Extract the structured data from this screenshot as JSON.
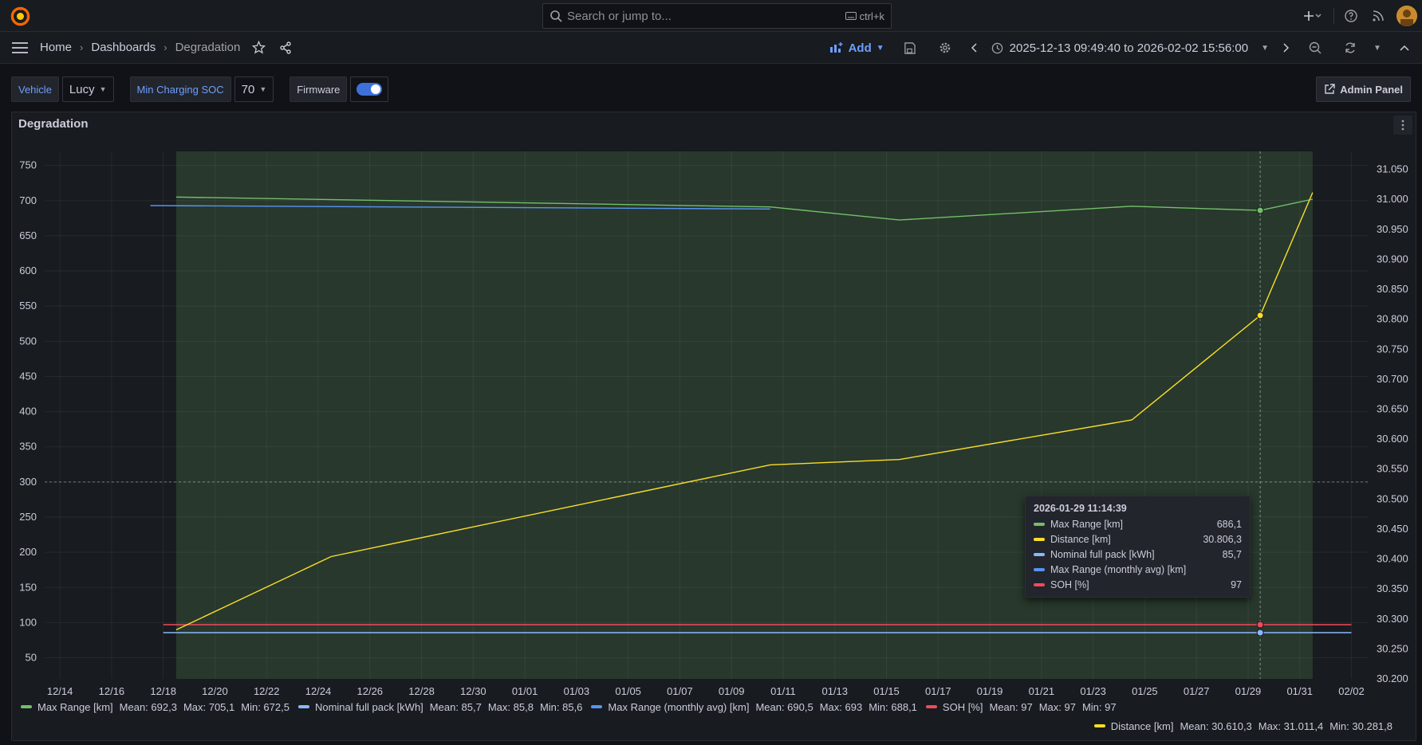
{
  "header": {
    "search_placeholder": "Search or jump to...",
    "search_shortcut": "ctrl+k",
    "icons": [
      "grafana-logo-icon",
      "plus-icon",
      "help-icon",
      "rss-icon",
      "avatar"
    ]
  },
  "nav": {
    "breadcrumb": [
      "Home",
      "Dashboards",
      "Degradation"
    ],
    "add_label": "Add",
    "time_range": "2025-12-13 09:49:40 to 2026-02-02 15:56:00"
  },
  "variables": {
    "vehicle_label": "Vehicle",
    "vehicle_value": "Lucy",
    "soc_label": "Min Charging SOC",
    "soc_value": "70",
    "firmware_label": "Firmware",
    "firmware_on": true,
    "admin_label": "Admin Panel"
  },
  "panel": {
    "title": "Degradation"
  },
  "tooltip": {
    "time": "2026-01-29 11:14:39",
    "rows": [
      {
        "name": "Max Range [km]",
        "value": "686,1",
        "color": "#73bf69"
      },
      {
        "name": "Distance [km]",
        "value": "30.806,3",
        "color": "#fade2a"
      },
      {
        "name": "Nominal full pack [kWh]",
        "value": "85,7",
        "color": "#8ab8ff"
      },
      {
        "name": "Max Range (monthly avg) [km]",
        "value": "",
        "color": "#5794f2"
      },
      {
        "name": "SOH [%]",
        "value": "97",
        "color": "#f2495c"
      }
    ]
  },
  "legend": {
    "row1": [
      {
        "name": "Max Range [km]",
        "color": "#73bf69",
        "mean": "Mean: 692,3",
        "max": "Max: 705,1",
        "min": "Min: 672,5"
      },
      {
        "name": "Nominal full pack [kWh]",
        "color": "#8ab8ff",
        "mean": "Mean: 85,7",
        "max": "Max: 85,8",
        "min": "Min: 85,6"
      },
      {
        "name": "Max Range (monthly avg) [km]",
        "color": "#5794f2",
        "mean": "Mean: 690,5",
        "max": "Max: 693",
        "min": "Min: 688,1"
      },
      {
        "name": "SOH [%]",
        "color": "#f2495c",
        "mean": "Mean: 97",
        "max": "Max: 97",
        "min": "Min: 97"
      }
    ],
    "row2": [
      {
        "name": "Distance [km]",
        "color": "#fade2a",
        "mean": "Mean: 30.610,3",
        "max": "Max: 31.011,4",
        "min": "Min: 30.281,8"
      }
    ]
  },
  "chart_data": {
    "type": "line",
    "x_ticks": [
      "12/14",
      "12/16",
      "12/18",
      "12/20",
      "12/22",
      "12/24",
      "12/26",
      "12/28",
      "12/30",
      "01/01",
      "01/03",
      "01/05",
      "01/07",
      "01/09",
      "01/11",
      "01/13",
      "01/15",
      "01/17",
      "01/19",
      "01/21",
      "01/23",
      "01/25",
      "01/27",
      "01/29",
      "01/31",
      "02/02"
    ],
    "x_range": [
      "2025-12-13 09:49:40",
      "2026-02-02 15:56:00"
    ],
    "y_left_ticks": [
      "750",
      "700",
      "650",
      "600",
      "550",
      "500",
      "450",
      "400",
      "350",
      "300",
      "250",
      "200",
      "150",
      "100",
      "50"
    ],
    "y_left_range": [
      20,
      770
    ],
    "y_right_ticks": [
      "31.050",
      "31.000",
      "30.950",
      "30.900",
      "30.850",
      "30.800",
      "30.750",
      "30.700",
      "30.650",
      "30.600",
      "30.550",
      "30.500",
      "30.450",
      "30.400",
      "30.350",
      "30.300",
      "30.250",
      "30.200"
    ],
    "y_right_range": [
      30.2,
      31.08
    ],
    "shaded_region": [
      "2025-12-18 12:00",
      "2026-01-31 12:00"
    ],
    "series": [
      {
        "name": "Max Range [km]",
        "axis": "left",
        "color": "#73bf69",
        "x": [
          "2025-12-18 12:00",
          "2026-01-10 12:00",
          "2026-01-15 12:00",
          "2026-01-24 12:00",
          "2026-01-29 11:14",
          "2026-01-31 12:00"
        ],
        "y": [
          705.1,
          691,
          672.5,
          692,
          686.1,
          702
        ]
      },
      {
        "name": "Nominal full pack [kWh]",
        "axis": "left",
        "color": "#8ab8ff",
        "x": [
          "2025-12-18 00:00",
          "2026-02-02 00:00"
        ],
        "y": [
          85.7,
          85.7
        ]
      },
      {
        "name": "Max Range (monthly avg) [km]",
        "axis": "left",
        "color": "#5794f2",
        "x": [
          "2025-12-17 12:00",
          "2026-01-10 12:00"
        ],
        "y": [
          693,
          688.1
        ]
      },
      {
        "name": "SOH [%]",
        "axis": "left",
        "color": "#f2495c",
        "x": [
          "2025-12-18 00:00",
          "2026-02-02 00:00"
        ],
        "y": [
          97,
          97
        ]
      },
      {
        "name": "Distance [km]",
        "axis": "right",
        "color": "#fade2a",
        "x": [
          "2025-12-18 12:00",
          "2025-12-24 12:00",
          "2026-01-10 12:00",
          "2026-01-15 12:00",
          "2026-01-24 12:00",
          "2026-01-29 11:14",
          "2026-01-31 12:00"
        ],
        "y": [
          30281.8,
          30404,
          30557,
          30566,
          30632,
          30806.3,
          31011.4
        ]
      }
    ],
    "hover_time": "2026-01-29 11:14:39",
    "hover_left_value": 300,
    "grid": true
  }
}
